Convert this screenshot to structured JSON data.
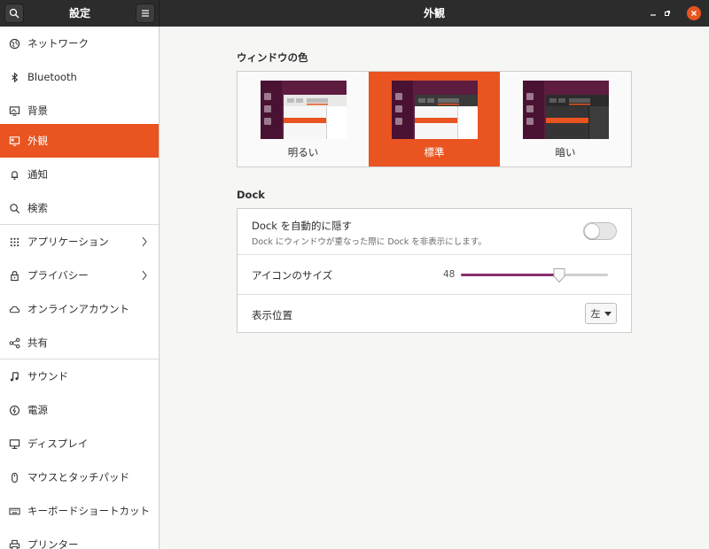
{
  "window": {
    "sidebar_title": "設定",
    "title": "外観"
  },
  "sidebar": {
    "items": [
      {
        "label": "ネットワーク",
        "icon": "network-icon"
      },
      {
        "label": "Bluetooth",
        "icon": "bluetooth-icon"
      },
      {
        "label": "背景",
        "icon": "background-icon"
      },
      {
        "label": "外観",
        "icon": "appearance-icon",
        "active": true
      },
      {
        "label": "通知",
        "icon": "bell-icon"
      },
      {
        "label": "検索",
        "icon": "search-icon"
      },
      {
        "label": "アプリケーション",
        "icon": "apps-grid-icon",
        "has_chevron": true
      },
      {
        "label": "プライバシー",
        "icon": "lock-icon",
        "has_chevron": true
      },
      {
        "label": "オンラインアカウント",
        "icon": "cloud-icon"
      },
      {
        "label": "共有",
        "icon": "share-icon"
      },
      {
        "label": "サウンド",
        "icon": "music-note-icon"
      },
      {
        "label": "電源",
        "icon": "power-icon"
      },
      {
        "label": "ディスプレイ",
        "icon": "display-icon"
      },
      {
        "label": "マウスとタッチパッド",
        "icon": "mouse-icon"
      },
      {
        "label": "キーボードショートカット",
        "icon": "keyboard-icon"
      },
      {
        "label": "プリンター",
        "icon": "printer-icon"
      }
    ]
  },
  "window_colors": {
    "title": "ウィンドウの色",
    "options": [
      {
        "label": "明るい",
        "selected": false
      },
      {
        "label": "標準",
        "selected": true
      },
      {
        "label": "暗い",
        "selected": false
      }
    ]
  },
  "dock": {
    "title": "Dock",
    "autohide": {
      "title": "Dock を自動的に隠す",
      "subtitle": "Dock にウィンドウが重なった際に Dock を非表示にします。",
      "enabled": false
    },
    "icon_size": {
      "title": "アイコンのサイズ",
      "value": "48",
      "fraction": 0.67
    },
    "position": {
      "title": "表示位置",
      "value": "左"
    }
  },
  "colors": {
    "accent": "#e95420",
    "aubergine": "#5e1c3f",
    "slider_fill": "#8a2d6e"
  }
}
